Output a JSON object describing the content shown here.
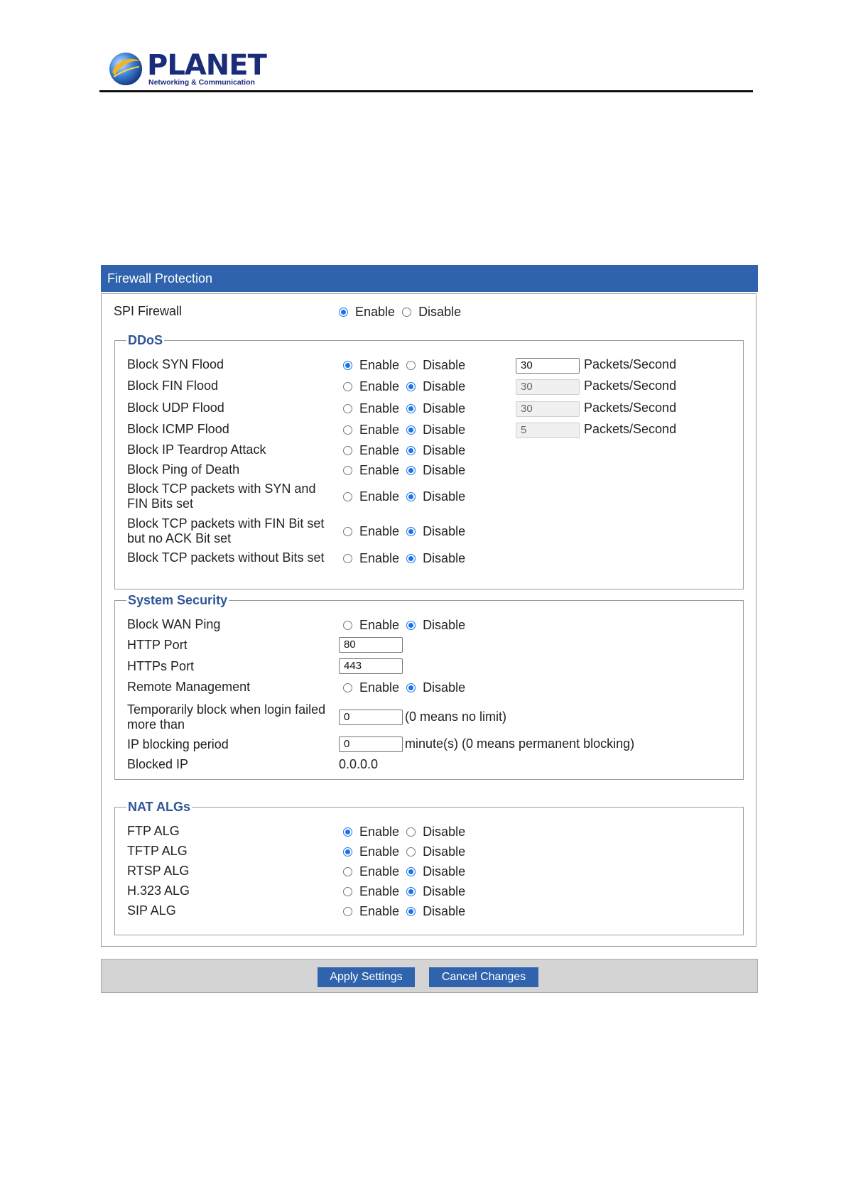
{
  "logo": {
    "brand": "PLANET",
    "tagline": "Networking & Communication"
  },
  "panel": {
    "title": "Firewall Protection"
  },
  "spi": {
    "label": "SPI Firewall",
    "enable": "Enable",
    "disable": "Disable",
    "selected": "enable"
  },
  "ddos": {
    "legend": "DDoS",
    "rows": [
      {
        "label": "Block SYN Flood",
        "selected": "enable",
        "rate": "30",
        "unit": "Packets/Second"
      },
      {
        "label": "Block FIN Flood",
        "selected": "disable",
        "rate": "30",
        "unit": "Packets/Second"
      },
      {
        "label": "Block UDP Flood",
        "selected": "disable",
        "rate": "30",
        "unit": "Packets/Second"
      },
      {
        "label": "Block ICMP Flood",
        "selected": "disable",
        "rate": "5",
        "unit": "Packets/Second"
      },
      {
        "label": "Block IP Teardrop Attack",
        "selected": "disable"
      },
      {
        "label": "Block Ping of Death",
        "selected": "disable"
      },
      {
        "label": "Block TCP packets with SYN and FIN Bits set",
        "selected": "disable"
      },
      {
        "label": "Block TCP packets with FIN Bit set but no ACK Bit set",
        "selected": "disable"
      },
      {
        "label": "Block TCP packets without Bits set",
        "selected": "disable"
      }
    ]
  },
  "radio_labels": {
    "enable": "Enable",
    "disable": "Disable"
  },
  "system_security": {
    "legend": "System Security",
    "block_wan_ping": {
      "label": "Block WAN Ping",
      "selected": "disable"
    },
    "http_port": {
      "label": "HTTP Port",
      "value": "80"
    },
    "https_port": {
      "label": "HTTPs Port",
      "value": "443"
    },
    "remote_mgmt": {
      "label": "Remote Management",
      "selected": "disable"
    },
    "login_block": {
      "label": "Temporarily block when login failed more than",
      "value": "0",
      "hint": "(0 means no limit)"
    },
    "block_period": {
      "label": "IP blocking period",
      "value": "0",
      "hint": "minute(s) (0 means permanent blocking)"
    },
    "blocked_ip": {
      "label": "Blocked IP",
      "value": "0.0.0.0"
    }
  },
  "nat_algs": {
    "legend": "NAT ALGs",
    "rows": [
      {
        "label": "FTP ALG",
        "selected": "enable"
      },
      {
        "label": "TFTP ALG",
        "selected": "enable"
      },
      {
        "label": "RTSP ALG",
        "selected": "disable"
      },
      {
        "label": "H.323 ALG",
        "selected": "disable"
      },
      {
        "label": "SIP ALG",
        "selected": "disable"
      }
    ]
  },
  "buttons": {
    "apply": "Apply Settings",
    "cancel": "Cancel Changes"
  },
  "colors": {
    "header_bar": "#2f63ad",
    "legend_text": "#2f5597",
    "radio_on": "#1a73e8",
    "footer_bar": "#d4d4d4"
  }
}
